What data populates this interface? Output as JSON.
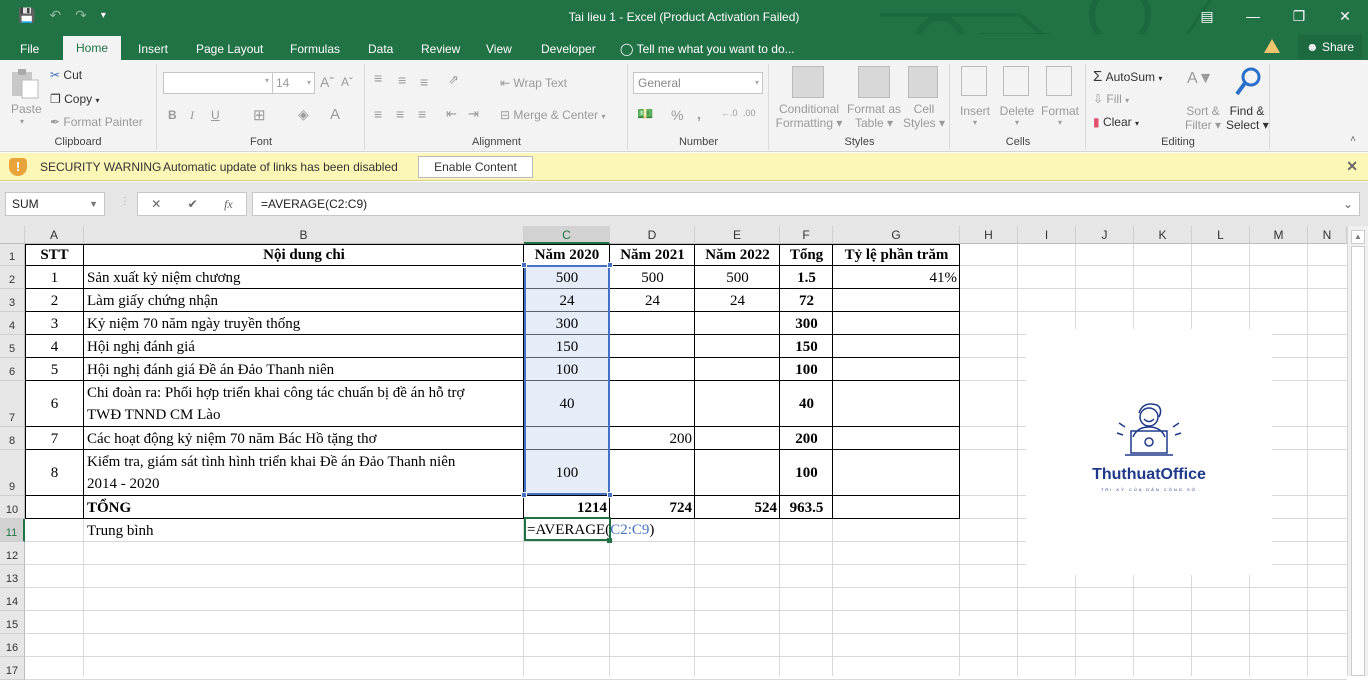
{
  "app": {
    "title": "Tai lieu 1 - Excel (Product Activation Failed)",
    "window_controls": [
      "ribbon-display-options",
      "minimize",
      "restore",
      "close"
    ]
  },
  "menu_tabs": [
    {
      "label": "File"
    },
    {
      "label": "Home",
      "active": true
    },
    {
      "label": "Insert"
    },
    {
      "label": "Page Layout"
    },
    {
      "label": "Formulas"
    },
    {
      "label": "Data"
    },
    {
      "label": "Review"
    },
    {
      "label": "View"
    },
    {
      "label": "Developer"
    }
  ],
  "tell_me": "Tell me what you want to do...",
  "share_label": "Share",
  "ribbon": {
    "clipboard": {
      "label": "Clipboard",
      "paste": "Paste",
      "cut": "Cut",
      "copy": "Copy",
      "format_painter": "Format Painter"
    },
    "font": {
      "label": "Font",
      "font_name": "",
      "font_size": "14",
      "bold": "B",
      "italic": "I",
      "underline": "U"
    },
    "alignment": {
      "label": "Alignment",
      "wrap_text": "Wrap Text",
      "merge_center": "Merge & Center"
    },
    "number": {
      "label": "Number",
      "format": "General",
      "percent": "%",
      "comma": ","
    },
    "styles": {
      "label": "Styles",
      "conditional_formatting_1": "Conditional",
      "conditional_formatting_2": "Formatting",
      "format_as_table_1": "Format as",
      "format_as_table_2": "Table",
      "cell_styles_1": "Cell",
      "cell_styles_2": "Styles"
    },
    "cells": {
      "label": "Cells",
      "insert": "Insert",
      "delete": "Delete",
      "format": "Format"
    },
    "editing": {
      "label": "Editing",
      "autosum": "AutoSum",
      "fill": "Fill",
      "clear": "Clear",
      "sort_filter_1": "Sort &",
      "sort_filter_2": "Filter",
      "find_select_1": "Find &",
      "find_select_2": "Select"
    }
  },
  "security_bar": {
    "title": "SECURITY WARNING",
    "message": "Automatic update of links has been disabled",
    "button": "Enable Content",
    "color": "#fcf7b6"
  },
  "formula_bar": {
    "name_box": "SUM",
    "formula": "=AVERAGE(C2:C9)"
  },
  "sheet": {
    "columns": [
      "A",
      "B",
      "C",
      "D",
      "E",
      "F",
      "G",
      "H",
      "I",
      "J",
      "K",
      "L",
      "M",
      "N"
    ],
    "rows": [
      "1",
      "2",
      "3",
      "4",
      "5",
      "6",
      "7",
      "8",
      "9",
      "10",
      "11",
      "12",
      "13",
      "14",
      "15",
      "16",
      "17"
    ],
    "header": {
      "stt": "STT",
      "content": "Nội dung chi",
      "y2020": "Năm 2020",
      "y2021": "Năm 2021",
      "y2022": "Năm 2022",
      "total": "Tổng",
      "percent": "Tỷ lệ phần trăm"
    },
    "data_rows": [
      {
        "stt": "1",
        "content": [
          "Sản xuất kỷ niệm chương"
        ],
        "y2020": "500",
        "y2021": "500",
        "y2022": "500",
        "total": "1.5",
        "percent": "41%"
      },
      {
        "stt": "2",
        "content": [
          "Làm giấy chứng nhận"
        ],
        "y2020": "24",
        "y2021": "24",
        "y2022": "24",
        "total": "72",
        "percent": ""
      },
      {
        "stt": "3",
        "content": [
          "Kỷ niệm 70 năm ngày truyền thống"
        ],
        "y2020": "300",
        "y2021": "",
        "y2022": "",
        "total": "300",
        "percent": ""
      },
      {
        "stt": "4",
        "content": [
          "Hội nghị đánh giá"
        ],
        "y2020": "150",
        "y2021": "",
        "y2022": "",
        "total": "150",
        "percent": ""
      },
      {
        "stt": "5",
        "content": [
          "Hội nghị đánh giá Đề án Đảo Thanh niên"
        ],
        "y2020": "100",
        "y2021": "",
        "y2022": "",
        "total": "100",
        "percent": ""
      },
      {
        "stt": "6",
        "content": [
          "Chi đoàn ra: Phối hợp triển khai công tác chuẩn bị đề án hỗ trợ",
          "TWĐ TNND CM Lào"
        ],
        "y2020": "40",
        "y2021": "",
        "y2022": "",
        "total": "40",
        "percent": ""
      },
      {
        "stt": "7",
        "content": [
          "Các hoạt động kỷ niệm 70 năm Bác Hồ tặng thơ"
        ],
        "y2020": "",
        "y2021": "200",
        "y2022": "",
        "total": "200",
        "percent": ""
      },
      {
        "stt": "8",
        "content": [
          "Kiểm tra, giám sát tình hình triển khai Đề án Đảo Thanh niên",
          "2014 - 2020"
        ],
        "y2020": "100",
        "y2021": "",
        "y2022": "",
        "total": "100",
        "percent": ""
      }
    ],
    "total_row": {
      "label": "TỔNG",
      "y2020": "1214",
      "y2021": "724",
      "y2022": "524",
      "total": "963.5"
    },
    "average_row": {
      "label": "Trung bình",
      "formula_prefix": "=AVERAGE(",
      "formula_ref": "C2:C9",
      "formula_suffix": ")"
    },
    "selection_color": "#4472c4",
    "active_color": "#217346"
  },
  "watermark": {
    "brand": "ThuthuatOffice",
    "tagline": "TRI KỶ CỦA DÂN CÔNG SỞ"
  }
}
